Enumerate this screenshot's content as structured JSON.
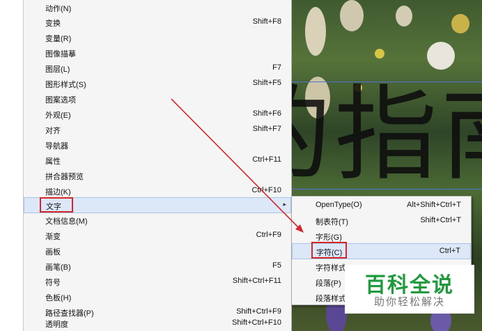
{
  "menu": {
    "items": [
      {
        "label": "动作(N)",
        "shortcut": ""
      },
      {
        "label": "变换",
        "shortcut": "Shift+F8"
      },
      {
        "label": "变量(R)",
        "shortcut": ""
      },
      {
        "label": "图像描摹",
        "shortcut": ""
      },
      {
        "label": "图层(L)",
        "shortcut": "F7"
      },
      {
        "label": "图形样式(S)",
        "shortcut": "Shift+F5"
      },
      {
        "label": "图案选项",
        "shortcut": ""
      },
      {
        "label": "外观(E)",
        "shortcut": "Shift+F6"
      },
      {
        "label": "对齐",
        "shortcut": "Shift+F7"
      },
      {
        "label": "导航器",
        "shortcut": ""
      },
      {
        "label": "属性",
        "shortcut": "Ctrl+F11"
      },
      {
        "label": "拼合器预览",
        "shortcut": ""
      },
      {
        "label": "描边(K)",
        "shortcut": "Ctrl+F10"
      },
      {
        "label": "文字",
        "shortcut": "",
        "has_submenu": true,
        "highlighted": true
      },
      {
        "label": "文档信息(M)",
        "shortcut": ""
      },
      {
        "label": "渐变",
        "shortcut": "Ctrl+F9"
      },
      {
        "label": "画板",
        "shortcut": ""
      },
      {
        "label": "画笔(B)",
        "shortcut": "F5"
      },
      {
        "label": "符号",
        "shortcut": "Shift+Ctrl+F11"
      },
      {
        "label": "色板(H)",
        "shortcut": ""
      },
      {
        "label": "路径查找器(P)",
        "shortcut": "Shift+Ctrl+F9"
      },
      {
        "label": "透明度",
        "shortcut": "Shift+Ctrl+F10"
      }
    ],
    "submenu_arrow": "▸"
  },
  "submenu": {
    "items": [
      {
        "label": "OpenType(O)",
        "shortcut": "Alt+Shift+Ctrl+T"
      },
      {
        "label": "制表符(T)",
        "shortcut": "Shift+Ctrl+T"
      },
      {
        "label": "字形(G)",
        "shortcut": ""
      },
      {
        "label": "字符(C)",
        "shortcut": "Ctrl+T",
        "highlighted": true
      },
      {
        "label": "字符样式",
        "shortcut": ""
      },
      {
        "label": "段落(P)",
        "shortcut": ""
      },
      {
        "label": "段落样式",
        "shortcut": ""
      }
    ]
  },
  "canvas": {
    "text": "的指南"
  },
  "watermark": {
    "title": "百科全说",
    "subtitle": "助你轻松解决"
  },
  "colors": {
    "highlight": "#dce8f8",
    "annotation_red": "#d6252b",
    "watermark_green": "#1f9a3c"
  }
}
